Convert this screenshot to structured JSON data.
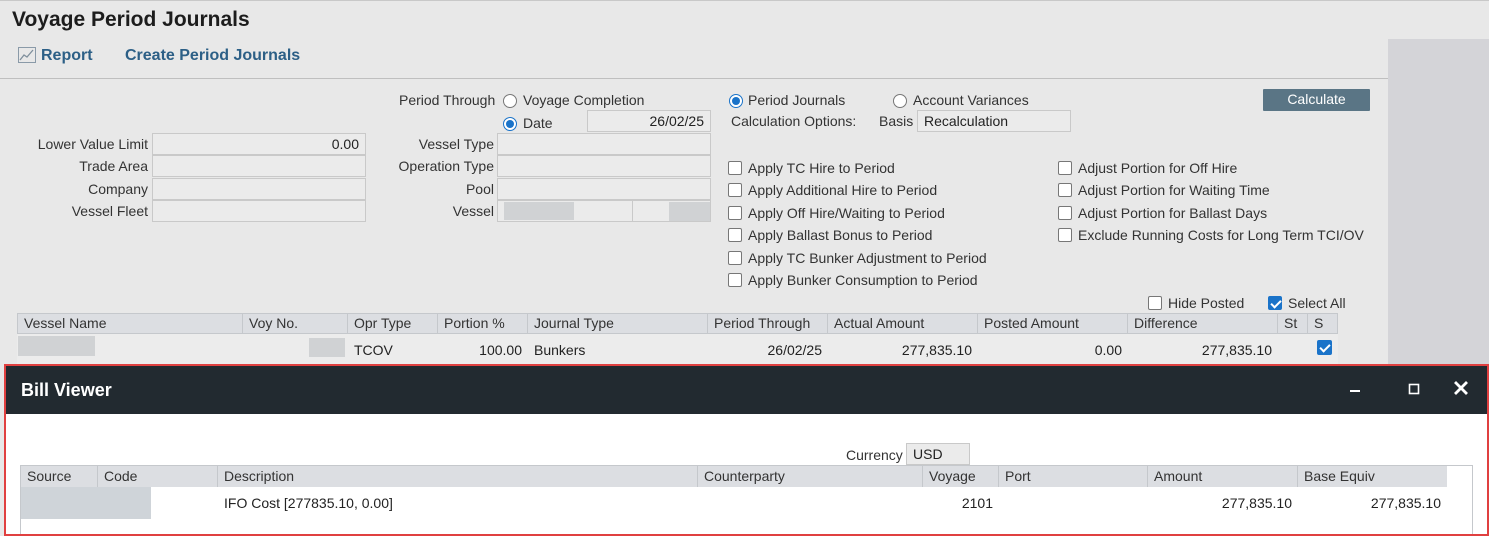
{
  "page": {
    "title": "Voyage Period Journals"
  },
  "toolbar": {
    "report_label": "Report",
    "create_label": "Create Period Journals"
  },
  "filters": {
    "lower_value_limit_label": "Lower Value Limit",
    "lower_value_limit_value": "0.00",
    "trade_area_label": "Trade Area",
    "company_label": "Company",
    "vessel_fleet_label": "Vessel Fleet",
    "period_through_label": "Period Through",
    "voyage_completion_label": "Voyage Completion",
    "date_label": "Date",
    "date_value": "26/02/25",
    "vessel_type_label": "Vessel Type",
    "operation_type_label": "Operation Type",
    "pool_label": "Pool",
    "vessel_label": "Vessel"
  },
  "options": {
    "period_journals_label": "Period Journals",
    "account_variances_label": "Account Variances",
    "calculation_options_label": "Calculation Options:",
    "basis_label": "Basis",
    "basis_value": "Recalculation",
    "calculate_label": "Calculate",
    "left_checks": [
      {
        "label": "Apply TC Hire to Period",
        "checked": false
      },
      {
        "label": "Apply Additional Hire to Period",
        "checked": false
      },
      {
        "label": "Apply Off Hire/Waiting to Period",
        "checked": false
      },
      {
        "label": "Apply Ballast Bonus to Period",
        "checked": false
      },
      {
        "label": "Apply TC Bunker Adjustment to Period",
        "checked": false
      },
      {
        "label": "Apply Bunker Consumption to Period",
        "checked": false
      }
    ],
    "right_checks": [
      {
        "label": "Adjust Portion for Off Hire",
        "checked": false
      },
      {
        "label": "Adjust Portion for Waiting Time",
        "checked": false
      },
      {
        "label": "Adjust Portion for Ballast Days",
        "checked": false
      },
      {
        "label": "Exclude Running Costs for Long Term TCI/OV",
        "checked": false
      }
    ],
    "hide_posted_label": "Hide Posted",
    "select_all_label": "Select All"
  },
  "grid": {
    "columns": [
      "Vessel Name",
      "Voy No.",
      "Opr Type",
      "Portion %",
      "Journal Type",
      "Period Through",
      "Actual Amount",
      "Posted Amount",
      "Difference",
      "St",
      "S"
    ],
    "rows": [
      {
        "vessel_name": "",
        "voy_no": "",
        "opr_type": "TCOV",
        "portion": "100.00",
        "journal_type": "Bunkers",
        "period_through": "26/02/25",
        "actual_amount": "277,835.10",
        "posted_amount": "0.00",
        "difference": "277,835.10",
        "st": "",
        "selected": true
      }
    ]
  },
  "bill_viewer": {
    "title": "Bill Viewer",
    "minimize_icon": "minimize-icon",
    "maximize_icon": "maximize-icon",
    "close_icon": "close-icon",
    "currency_label": "Currency",
    "currency_value": "USD",
    "columns": [
      "Source",
      "Code",
      "Description",
      "Counterparty",
      "Voyage",
      "Port",
      "Amount",
      "Base Equiv"
    ],
    "rows": [
      {
        "source": "",
        "code": "",
        "description": "IFO Cost [277835.10, 0.00]",
        "counterparty": "",
        "voyage": "2101",
        "port": "",
        "amount": "277,835.10",
        "base_equiv": "277,835.10"
      }
    ]
  },
  "colors": {
    "accent": "#1a73c9",
    "link": "#2c5f86",
    "dialog_header": "#222a30",
    "highlight_border": "#e04040",
    "button": "#5a7585"
  }
}
